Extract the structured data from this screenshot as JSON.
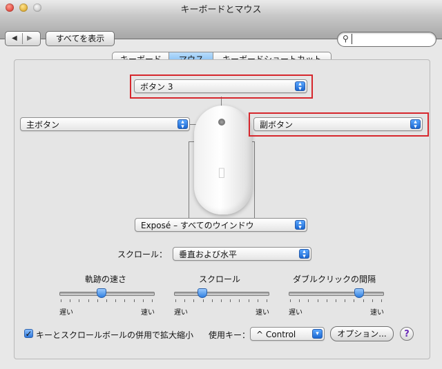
{
  "window": {
    "title": "キーボードとマウス"
  },
  "toolbar": {
    "show_all_label": "すべてを表示",
    "search_value": ""
  },
  "tabs": [
    {
      "label": "キーボード",
      "selected": false
    },
    {
      "label": "マウス",
      "selected": true
    },
    {
      "label": "キーボードショートカット",
      "selected": false
    }
  ],
  "mouse_buttons": {
    "top_popup": "ボタン 3",
    "left_popup": "主ボタン",
    "right_popup": "副ボタン",
    "bottom_popup": "Exposé – すべてのウインドウ"
  },
  "scroll": {
    "label": "スクロール：",
    "value": "垂直および水平"
  },
  "sliders": [
    {
      "label": "軌跡の速さ",
      "min_label": "遅い",
      "max_label": "速い",
      "position_fraction": 0.45
    },
    {
      "label": "スクロール",
      "min_label": "遅い",
      "max_label": "速い",
      "position_fraction": 0.3
    },
    {
      "label": "ダブルクリックの間隔",
      "min_label": "遅い",
      "max_label": "速い",
      "position_fraction": 0.75
    }
  ],
  "zoom": {
    "checkbox_label": "キーとスクロールボールの併用で拡大縮小",
    "checked": true,
    "key_label": "使用キー：",
    "key_value": "^ Control",
    "options_label": "オプション...",
    "help_label": "?"
  }
}
